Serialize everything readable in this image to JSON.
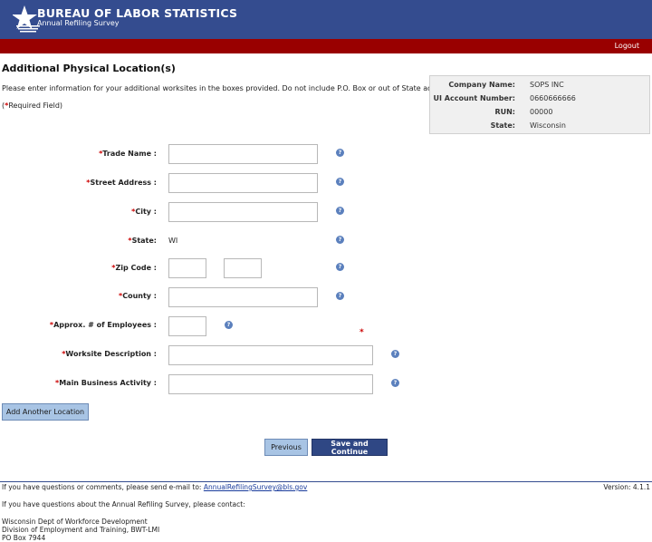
{
  "header": {
    "brand": "BUREAU OF LABOR STATISTICS",
    "subtitle": "Annual Refiling Survey",
    "logout": "Logout"
  },
  "page": {
    "title": "Additional Physical Location(s)",
    "intro": "Please enter information for your additional worksites in the boxes provided. Do not include P.O. Box or out of State addresses.",
    "required_open": "(",
    "required_star": "*",
    "required_text": "Required Field)"
  },
  "account_info": [
    {
      "label": "Company Name:",
      "value": "SOPS INC"
    },
    {
      "label": "UI Account Number:",
      "value": "0660666666"
    },
    {
      "label": "RUN:",
      "value": "00000"
    },
    {
      "label": "State:",
      "value": "Wisconsin"
    }
  ],
  "form": {
    "star": "*",
    "trade_name": {
      "label": "Trade Name :",
      "value": ""
    },
    "street_address": {
      "label": "Street Address :",
      "value": ""
    },
    "city": {
      "label": "City :",
      "value": ""
    },
    "state": {
      "label": "State:",
      "value": "WI"
    },
    "zip_code": {
      "label": "Zip Code :",
      "value": "",
      "ext_value": ""
    },
    "county": {
      "label": "County :",
      "value": ""
    },
    "employees": {
      "label": "Approx. # of Employees :",
      "value": ""
    },
    "worksite_description": {
      "label": "Worksite Description :",
      "value": ""
    },
    "main_business_activity": {
      "label": "Main Business Activity :",
      "value": ""
    },
    "help_glyph": "?"
  },
  "buttons": {
    "add_location": "Add Another Location",
    "previous": "Previous",
    "save_continue": "Save and Continue"
  },
  "footer": {
    "questions_text": "If you have questions or comments, please send e-mail to:",
    "email": "AnnualRefilingSurvey@bls.gov",
    "version": "Version: 4.1.1",
    "contact_text": "If you have questions about the Annual Refiling Survey, please contact:",
    "address_line1": "Wisconsin Dept of Workforce Development",
    "address_line2": "Division of Employment and Training, BWT-LMI",
    "address_line3": "PO Box 7944"
  }
}
